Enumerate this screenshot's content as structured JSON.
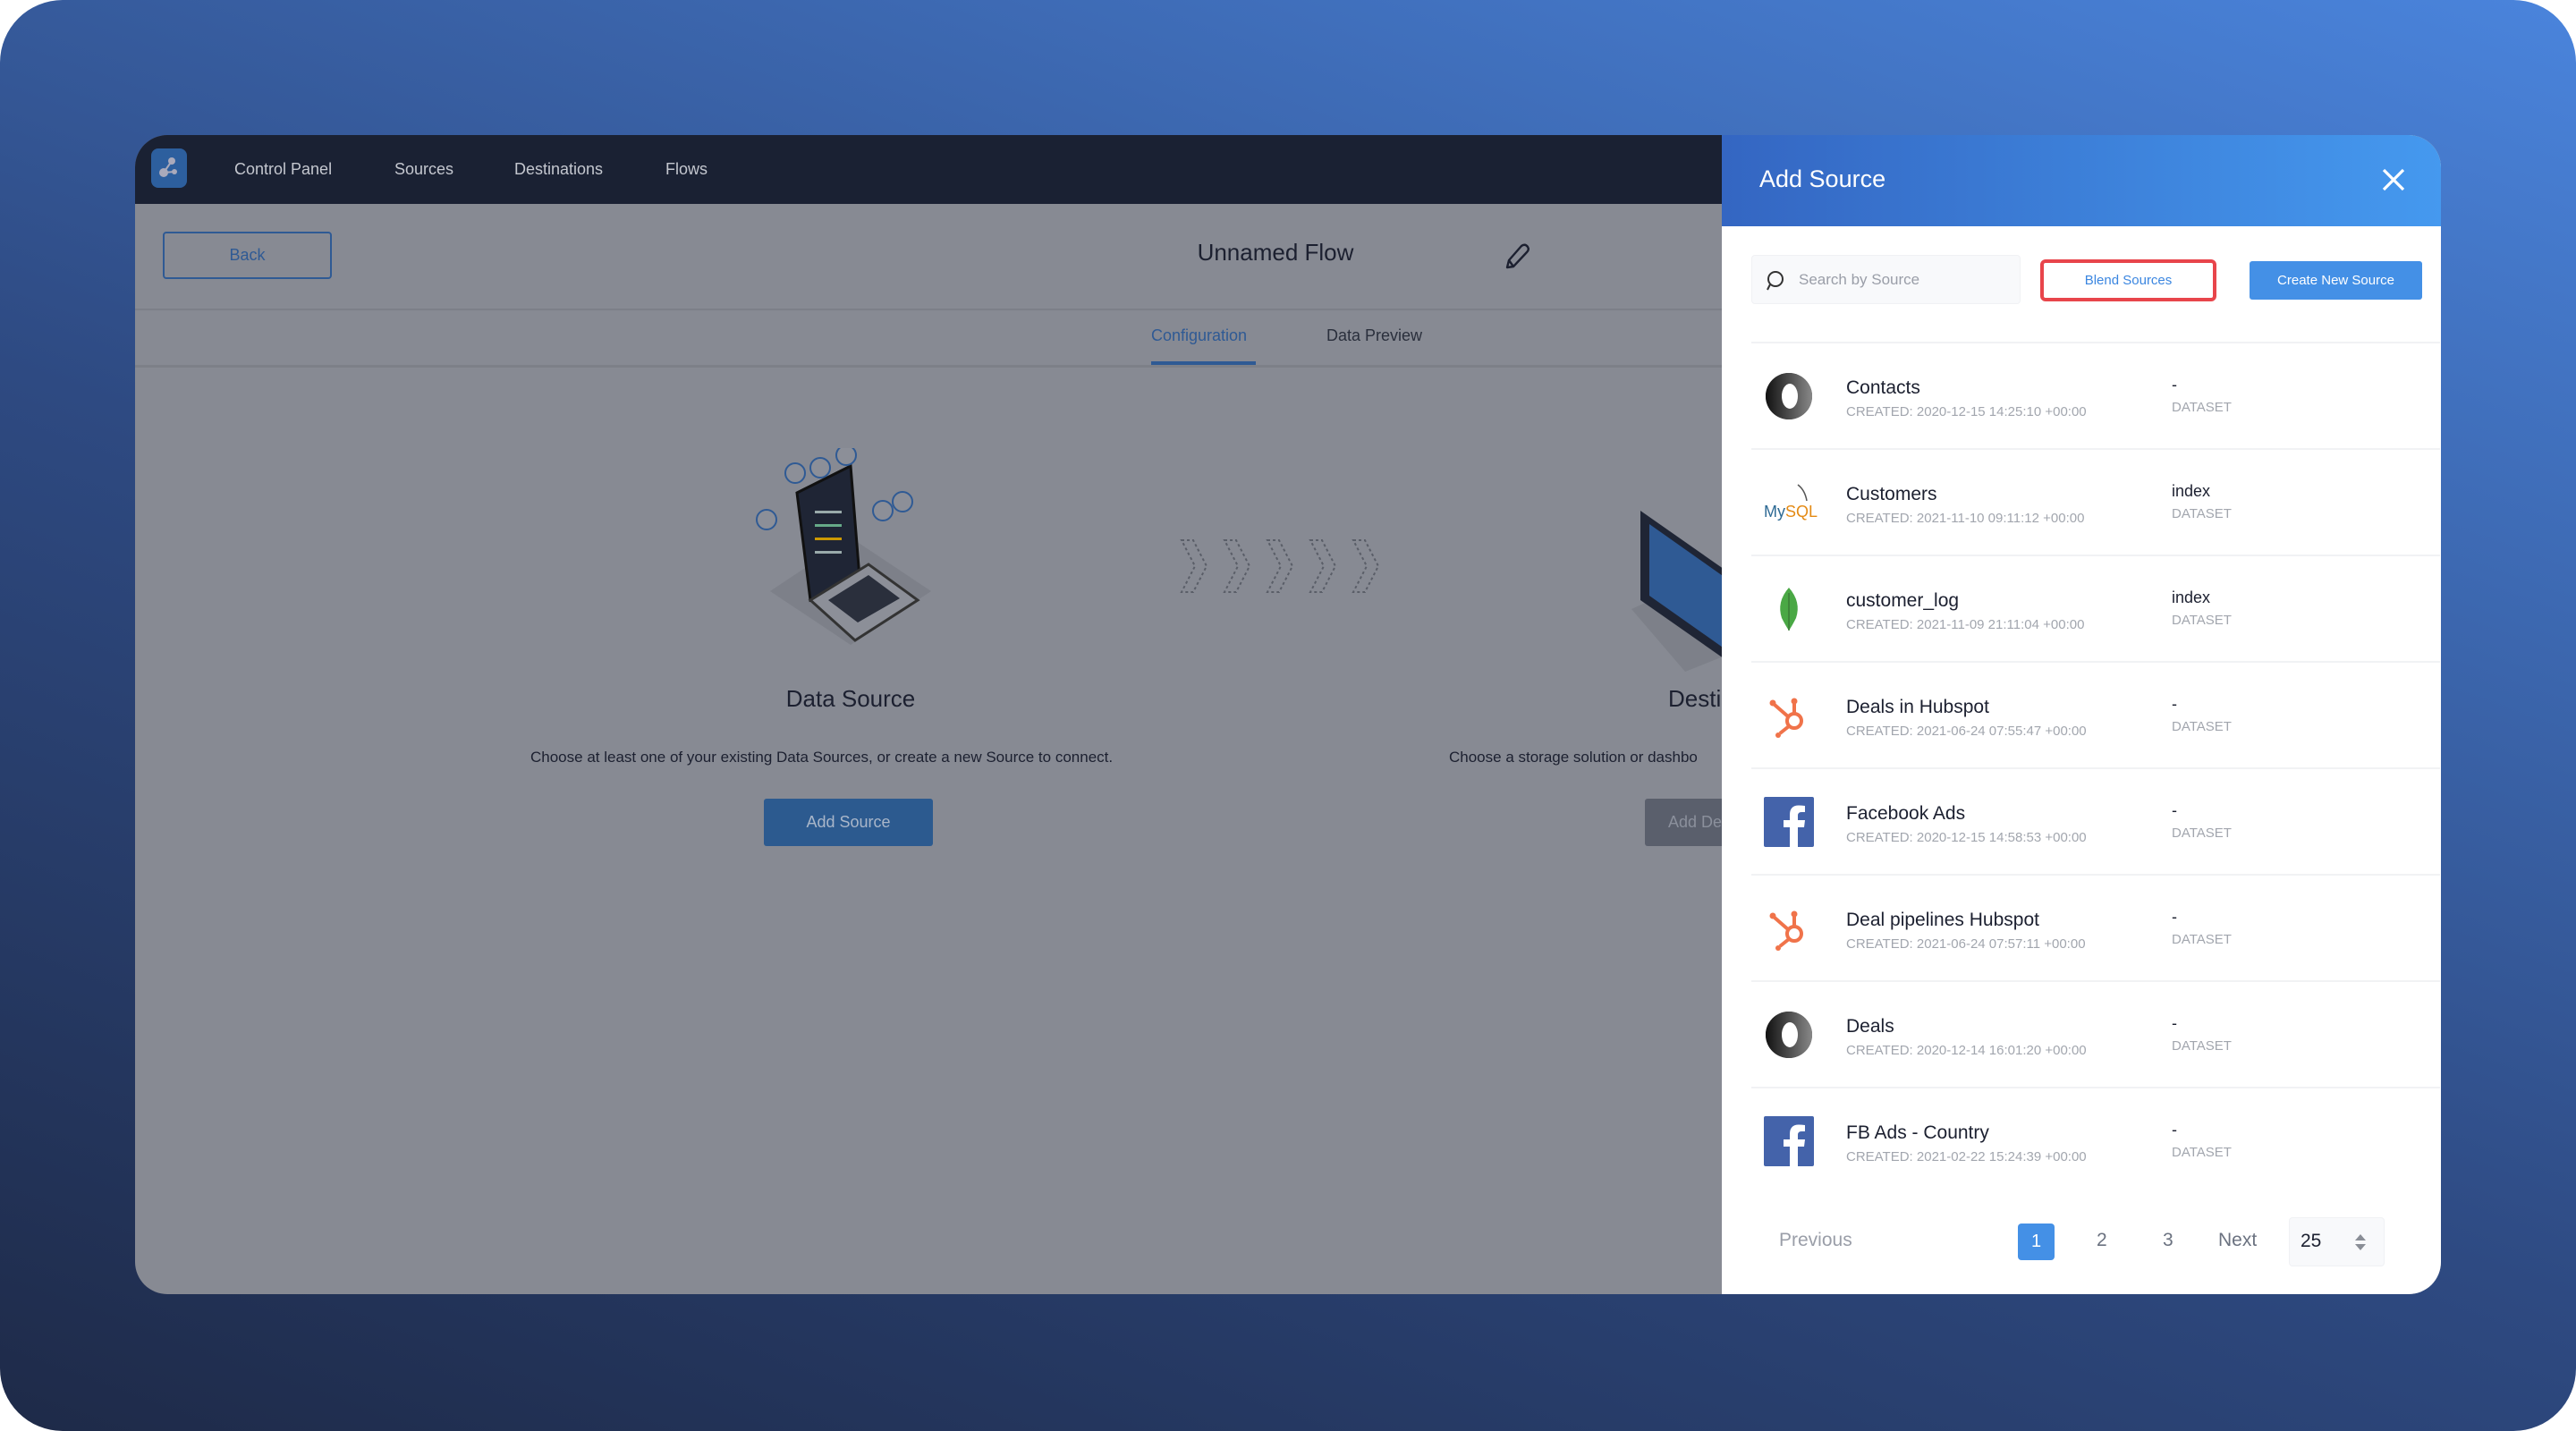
{
  "nav": {
    "items": [
      "Control Panel",
      "Sources",
      "Destinations",
      "Flows"
    ]
  },
  "flow": {
    "back_label": "Back",
    "title": "Unnamed Flow",
    "tabs": [
      {
        "label": "Configuration",
        "active": true
      },
      {
        "label": "Data Preview",
        "active": false
      }
    ]
  },
  "steps": {
    "source": {
      "title": "Data Source",
      "description": "Choose at least one of your existing Data Sources, or create a new Source to connect.",
      "button": "Add Source"
    },
    "destination": {
      "title": "Desti",
      "description": "Choose a storage solution or dashbo",
      "button": "Add De"
    }
  },
  "panel": {
    "title": "Add Source",
    "search_placeholder": "Search by Source",
    "blend_label": "Blend Sources",
    "create_label": "Create New Source",
    "rows": [
      {
        "name": "Contacts",
        "created": "CREATED: 2020-12-15 14:25:10 +00:00",
        "tag": "-",
        "type": "DATASET",
        "icon": "json-icon"
      },
      {
        "name": "Customers",
        "created": "CREATED: 2021-11-10 09:11:12 +00:00",
        "tag": "index",
        "type": "DATASET",
        "icon": "mysql-icon"
      },
      {
        "name": "customer_log",
        "created": "CREATED: 2021-11-09 21:11:04 +00:00",
        "tag": "index",
        "type": "DATASET",
        "icon": "mongodb-icon"
      },
      {
        "name": "Deals in Hubspot",
        "created": "CREATED: 2021-06-24 07:55:47 +00:00",
        "tag": "-",
        "type": "DATASET",
        "icon": "hubspot-icon"
      },
      {
        "name": "Facebook Ads",
        "created": "CREATED: 2020-12-15 14:58:53 +00:00",
        "tag": "-",
        "type": "DATASET",
        "icon": "facebook-icon"
      },
      {
        "name": "Deal pipelines Hubspot",
        "created": "CREATED: 2021-06-24 07:57:11 +00:00",
        "tag": "-",
        "type": "DATASET",
        "icon": "hubspot-icon"
      },
      {
        "name": "Deals",
        "created": "CREATED: 2020-12-14 16:01:20 +00:00",
        "tag": "-",
        "type": "DATASET",
        "icon": "json-icon"
      },
      {
        "name": "FB Ads - Country",
        "created": "CREATED: 2021-02-22 15:24:39 +00:00",
        "tag": "-",
        "type": "DATASET",
        "icon": "facebook-icon"
      }
    ],
    "pagination": {
      "previous": "Previous",
      "pages": [
        "1",
        "2",
        "3"
      ],
      "current": "1",
      "next": "Next",
      "page_size": "25"
    },
    "colors": {
      "accent": "#4490e6",
      "highlight": "#e8454b"
    }
  }
}
